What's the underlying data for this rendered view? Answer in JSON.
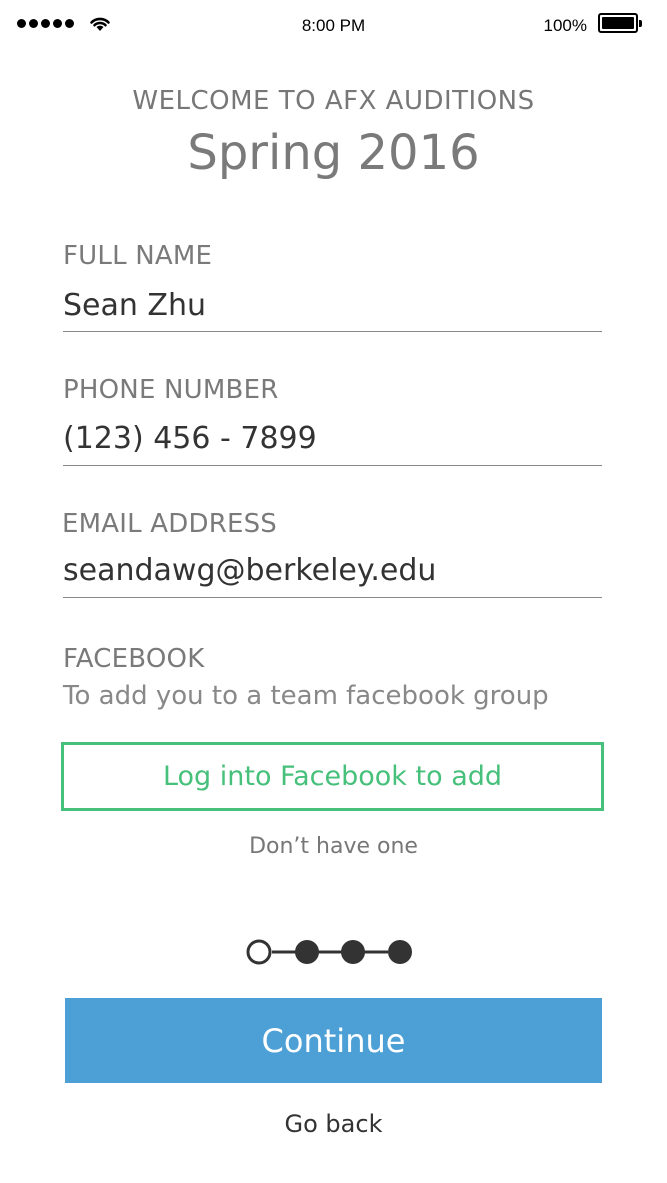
{
  "status_bar": {
    "time": "8:00 PM",
    "battery_percent": "100%",
    "battery_level": 1.0,
    "signal_bars": 5
  },
  "header": {
    "welcome": "WELCOME TO AFX AUDITIONS",
    "season": "Spring 2016"
  },
  "form": {
    "full_name": {
      "label": "FULL NAME",
      "value": "Sean Zhu"
    },
    "phone": {
      "label": "PHONE NUMBER",
      "value": "(123) 456 - 7899"
    },
    "email": {
      "label": "EMAIL ADDRESS",
      "value": "seandawg@berkeley.edu"
    },
    "facebook": {
      "label": "FACEBOOK",
      "description": "To add you to a team facebook group",
      "button_label": "Log into Facebook to add",
      "no_account_label": "Don’t have one"
    }
  },
  "progress": {
    "total_steps": 4,
    "current_step": 1
  },
  "actions": {
    "continue_label": "Continue",
    "go_back_label": "Go back"
  },
  "colors": {
    "accent_green": "#46c07a",
    "primary_blue": "#4ca0d6",
    "label_gray": "#7a7a7a",
    "text_dark": "#333333"
  }
}
